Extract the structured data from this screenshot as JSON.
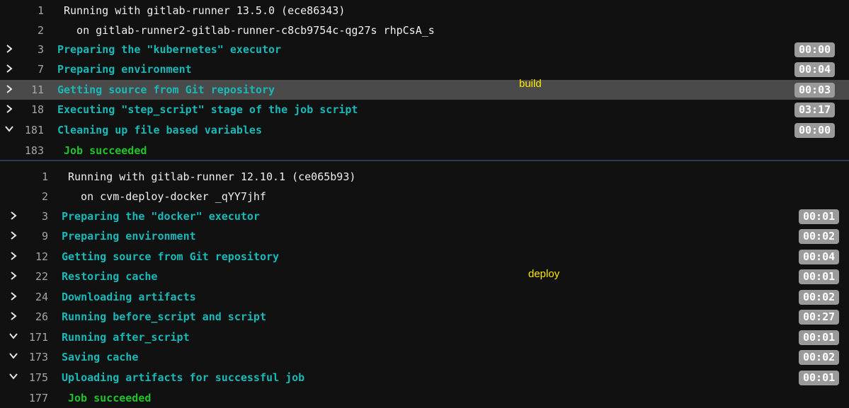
{
  "build": {
    "stage_label": "build",
    "header": [
      {
        "num": "1",
        "text": "Running with gitlab-runner 13.5.0 (ece86343)"
      },
      {
        "num": "2",
        "text": "  on gitlab-runner2-gitlab-runner-c8cb9754c-qg27s rhpCsA_s"
      }
    ],
    "sections": [
      {
        "num": "3",
        "text": "Preparing the \"kubernetes\" executor",
        "time": "00:00",
        "state": "collapsed"
      },
      {
        "num": "7",
        "text": "Preparing environment",
        "time": "00:04",
        "state": "collapsed"
      },
      {
        "num": "11",
        "text": "Getting source from Git repository",
        "time": "00:03",
        "state": "collapsed"
      },
      {
        "num": "18",
        "text": "Executing \"step_script\" stage of the job script",
        "time": "03:17",
        "state": "collapsed"
      },
      {
        "num": "181",
        "text": "Cleaning up file based variables",
        "time": "00:00",
        "state": "expanded"
      }
    ],
    "footer": {
      "num": "183",
      "text": "Job succeeded"
    }
  },
  "deploy": {
    "stage_label": "deploy",
    "header": [
      {
        "num": "1",
        "text": "Running with gitlab-runner 12.10.1 (ce065b93)"
      },
      {
        "num": "2",
        "text": "  on cvm-deploy-docker _qYY7jhf"
      }
    ],
    "sections": [
      {
        "num": "3",
        "text": "Preparing the \"docker\" executor",
        "time": "00:01",
        "state": "collapsed"
      },
      {
        "num": "9",
        "text": "Preparing environment",
        "time": "00:02",
        "state": "collapsed"
      },
      {
        "num": "12",
        "text": "Getting source from Git repository",
        "time": "00:04",
        "state": "collapsed"
      },
      {
        "num": "22",
        "text": "Restoring cache",
        "time": "00:01",
        "state": "collapsed"
      },
      {
        "num": "24",
        "text": "Downloading artifacts",
        "time": "00:02",
        "state": "collapsed"
      },
      {
        "num": "26",
        "text": "Running before_script and script",
        "time": "00:27",
        "state": "collapsed"
      },
      {
        "num": "171",
        "text": "Running after_script",
        "time": "00:01",
        "state": "expanded"
      },
      {
        "num": "173",
        "text": "Saving cache",
        "time": "00:02",
        "state": "expanded"
      },
      {
        "num": "175",
        "text": "Uploading artifacts for successful job",
        "time": "00:01",
        "state": "expanded"
      }
    ],
    "footer": {
      "num": "177",
      "text": "Job succeeded"
    }
  },
  "colors": {
    "background": "#111111",
    "section_text": "#1bb8b8",
    "success_text": "#22c22a",
    "badge_bg": "#9a9a9a",
    "stage_label": "#ffe800",
    "highlight_row": "#4a4a4a"
  },
  "icons": {
    "collapsed": "chevron-right-icon",
    "expanded": "chevron-down-icon"
  }
}
